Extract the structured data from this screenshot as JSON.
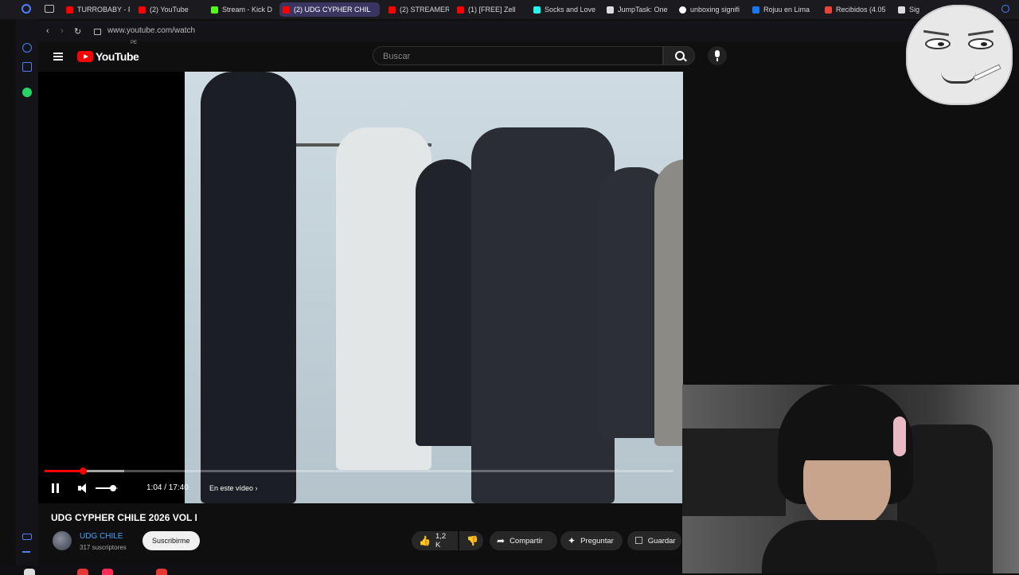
{
  "browser": {
    "tabs": [
      {
        "label": "TURROBABY - F",
        "icon": "youtube-icon",
        "active": false
      },
      {
        "label": "(2) YouTube",
        "icon": "youtube-icon",
        "active": false
      },
      {
        "label": "Stream - Kick D",
        "icon": "kick-icon",
        "active": false
      },
      {
        "label": "(2) UDG CYPHER CHIL",
        "icon": "youtube-icon",
        "active": true
      },
      {
        "label": "(2) STREAMER",
        "icon": "youtube-icon",
        "active": false
      },
      {
        "label": "(1) [FREE] Zell",
        "icon": "youtube-icon",
        "active": false
      },
      {
        "label": "Socks and Love",
        "icon": "tiktok-icon",
        "active": false
      },
      {
        "label": "JumpTask: One",
        "icon": "page-icon",
        "active": false
      },
      {
        "label": "unboxing signifi",
        "icon": "google-icon",
        "active": false
      },
      {
        "label": "Rojuu en Lima",
        "icon": "facebook-icon",
        "active": false
      },
      {
        "label": "Recibidos (4.05",
        "icon": "gmail-icon",
        "active": false
      },
      {
        "label": "Sig",
        "icon": "page-icon",
        "active": false
      }
    ],
    "url": "www.youtube.com/watch"
  },
  "youtube": {
    "logo_text": "YouTube",
    "country_code": "PE",
    "search_placeholder": "Buscar"
  },
  "player": {
    "current_time": "1:04",
    "duration": "17:40",
    "time_display": "1:04 / 17:40",
    "progress_fraction": 0.0604,
    "volume_fraction": 0.8,
    "chapter_label": "En este vídeo"
  },
  "video": {
    "title": "UDG CYPHER CHILE 2026 VOL I",
    "channel": "UDG CHILE",
    "subscribers": "317 suscriptores",
    "subscribe_label": "Suscribirme",
    "likes": "1,2 K",
    "share_label": "Compartir",
    "ask_label": "Preguntar",
    "save_label": "Guardar"
  },
  "colors": {
    "youtube_red": "#ff0000",
    "link_blue": "#3ea6ff",
    "active_tab": "#3a3560",
    "opera_blue": "#4d7cff"
  }
}
